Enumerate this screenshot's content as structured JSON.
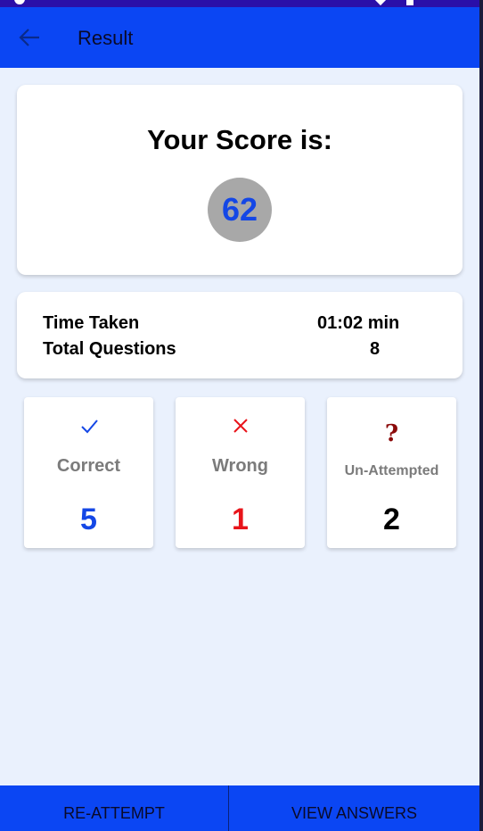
{
  "app_bar": {
    "title": "Result",
    "back_icon": "arrow-left-icon"
  },
  "score": {
    "title": "Your Score is:",
    "value": "62"
  },
  "info": {
    "time_label": "Time Taken",
    "time_value": "01:02 min",
    "questions_label": "Total Questions",
    "questions_value": "8"
  },
  "stats": [
    {
      "icon": "check-icon",
      "label": "Correct",
      "value": "5",
      "color": "#1447e6"
    },
    {
      "icon": "close-icon",
      "label": "Wrong",
      "value": "1",
      "color": "#e8141a"
    },
    {
      "icon": "question-icon",
      "label": "Un-Attempted",
      "value": "2",
      "color": "#000000"
    }
  ],
  "actions": {
    "reattempt_label": "RE-ATTEMPT",
    "view_answers_label": "VIEW ANSWERS"
  },
  "colors": {
    "primary": "#0b46f3",
    "background": "#eaf1fd"
  }
}
